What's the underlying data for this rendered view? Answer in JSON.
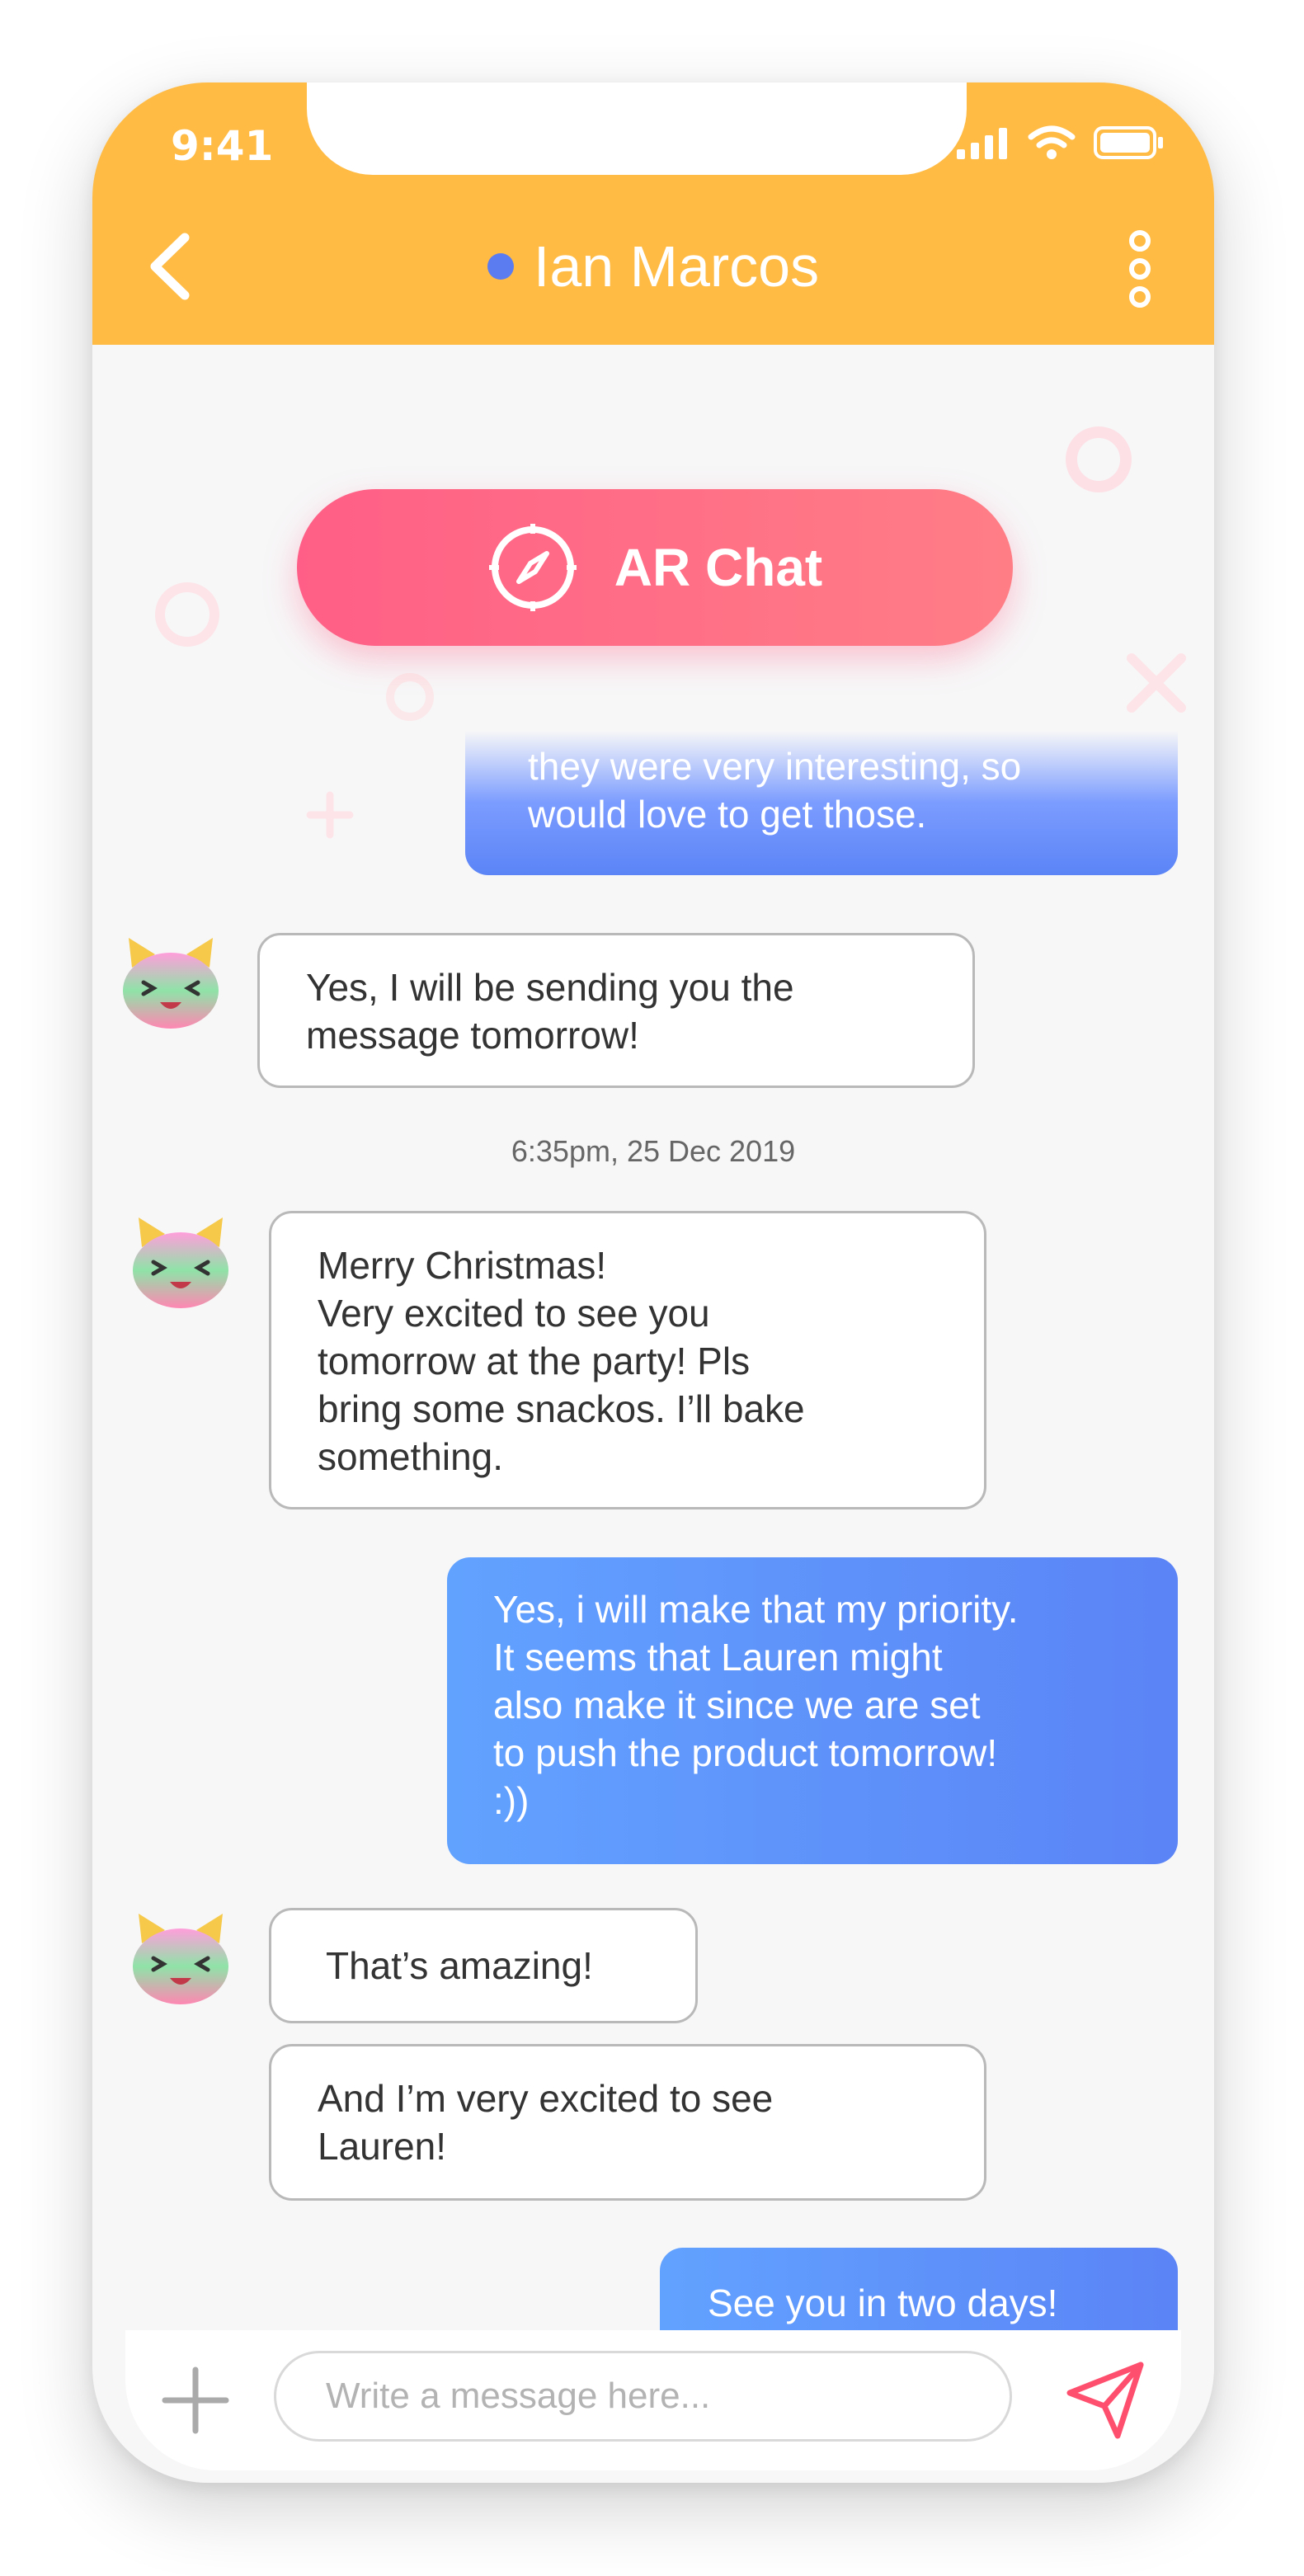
{
  "status_bar": {
    "time": "9:41",
    "icons": [
      "signal-icon",
      "wifi-icon",
      "battery-icon"
    ]
  },
  "header": {
    "title": "Ian Marcos",
    "online_color": "#5b7cf0",
    "background_color": "#ffbb44",
    "icons": [
      "chevron-left-icon",
      "more-vertical-icon"
    ]
  },
  "ar_chat": {
    "label": "AR Chat",
    "icon": "compass-icon",
    "colors": [
      "#ff5f86",
      "#ff7e86"
    ]
  },
  "messages": [
    {
      "direction": "outgoing",
      "text": "they were very interesting, so\nwould love to get those."
    },
    {
      "direction": "incoming",
      "text": "Yes, I will be sending you the\nmessage tomorrow!"
    },
    {
      "direction": "incoming",
      "text": "Merry Christmas!\nVery excited to see you\ntomorrow at the party! Pls\nbring some snackos. I’ll bake\nsomething."
    },
    {
      "direction": "outgoing",
      "text": "Yes, i will make that my priority.\nIt seems that Lauren might\nalso make it since we are set\nto push the product tomorrow!\n:))"
    },
    {
      "direction": "incoming",
      "text": "That’s amazing!"
    },
    {
      "direction": "incoming",
      "text": "And I’m very excited to see\nLauren!"
    },
    {
      "direction": "outgoing",
      "text": "See you in two days!"
    }
  ],
  "timestamp": "6:35pm, 25 Dec 2019",
  "composer": {
    "placeholder": "Write a message here...",
    "value": "",
    "icons": [
      "plus-icon",
      "send-icon"
    ]
  },
  "colors": {
    "outgoing_bubble": [
      "#62a2ff",
      "#5b84f6"
    ],
    "incoming_border": "#b9b9b9",
    "send_icon": "#ff4f6e"
  }
}
